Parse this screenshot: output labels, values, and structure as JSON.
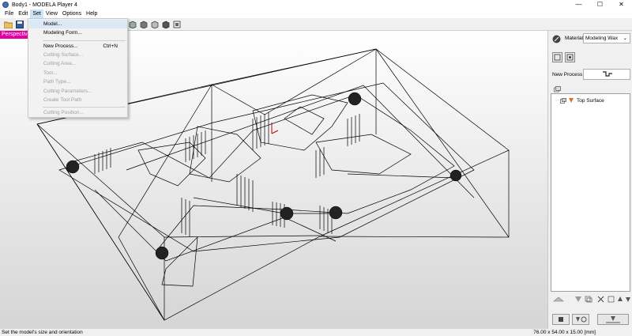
{
  "window": {
    "title": "Body1 - MODELA Player 4",
    "minimize": "—",
    "maximize": "☐",
    "close": "✕"
  },
  "menu": [
    "File",
    "Edit",
    "Set",
    "View",
    "Options",
    "Help"
  ],
  "dropdown": {
    "items": [
      {
        "label": "Model...",
        "shortcut": "",
        "enabled": true,
        "highlighted": true
      },
      {
        "label": "Modeling Form...",
        "shortcut": "",
        "enabled": true
      },
      {
        "label": "New Process...",
        "shortcut": "Ctrl+N",
        "enabled": true
      },
      {
        "label": "Cutting Surface...",
        "shortcut": "",
        "enabled": false
      },
      {
        "label": "Cutting Area...",
        "shortcut": "",
        "enabled": false
      },
      {
        "label": "Tool...",
        "shortcut": "",
        "enabled": false
      },
      {
        "label": "Path Type...",
        "shortcut": "",
        "enabled": false
      },
      {
        "label": "Cutting Parameters...",
        "shortcut": "",
        "enabled": false
      },
      {
        "label": "Create Tool Path",
        "shortcut": "",
        "enabled": false
      },
      {
        "label": "Cutting Position...",
        "shortcut": "",
        "enabled": false
      }
    ]
  },
  "viewport": {
    "view_label": "Perspective"
  },
  "panel": {
    "material_label": "Material",
    "material_value": "Modeling Wax",
    "new_process_label": "New Process",
    "tree_item": "Top Surface"
  },
  "status": {
    "message": "Set the model's size and orientation",
    "size": "76.00 x 54.00 x 15.00 [mm]"
  },
  "colors": {
    "view_label_bg": "#e000a0",
    "highlight": "#dbe9f7"
  }
}
